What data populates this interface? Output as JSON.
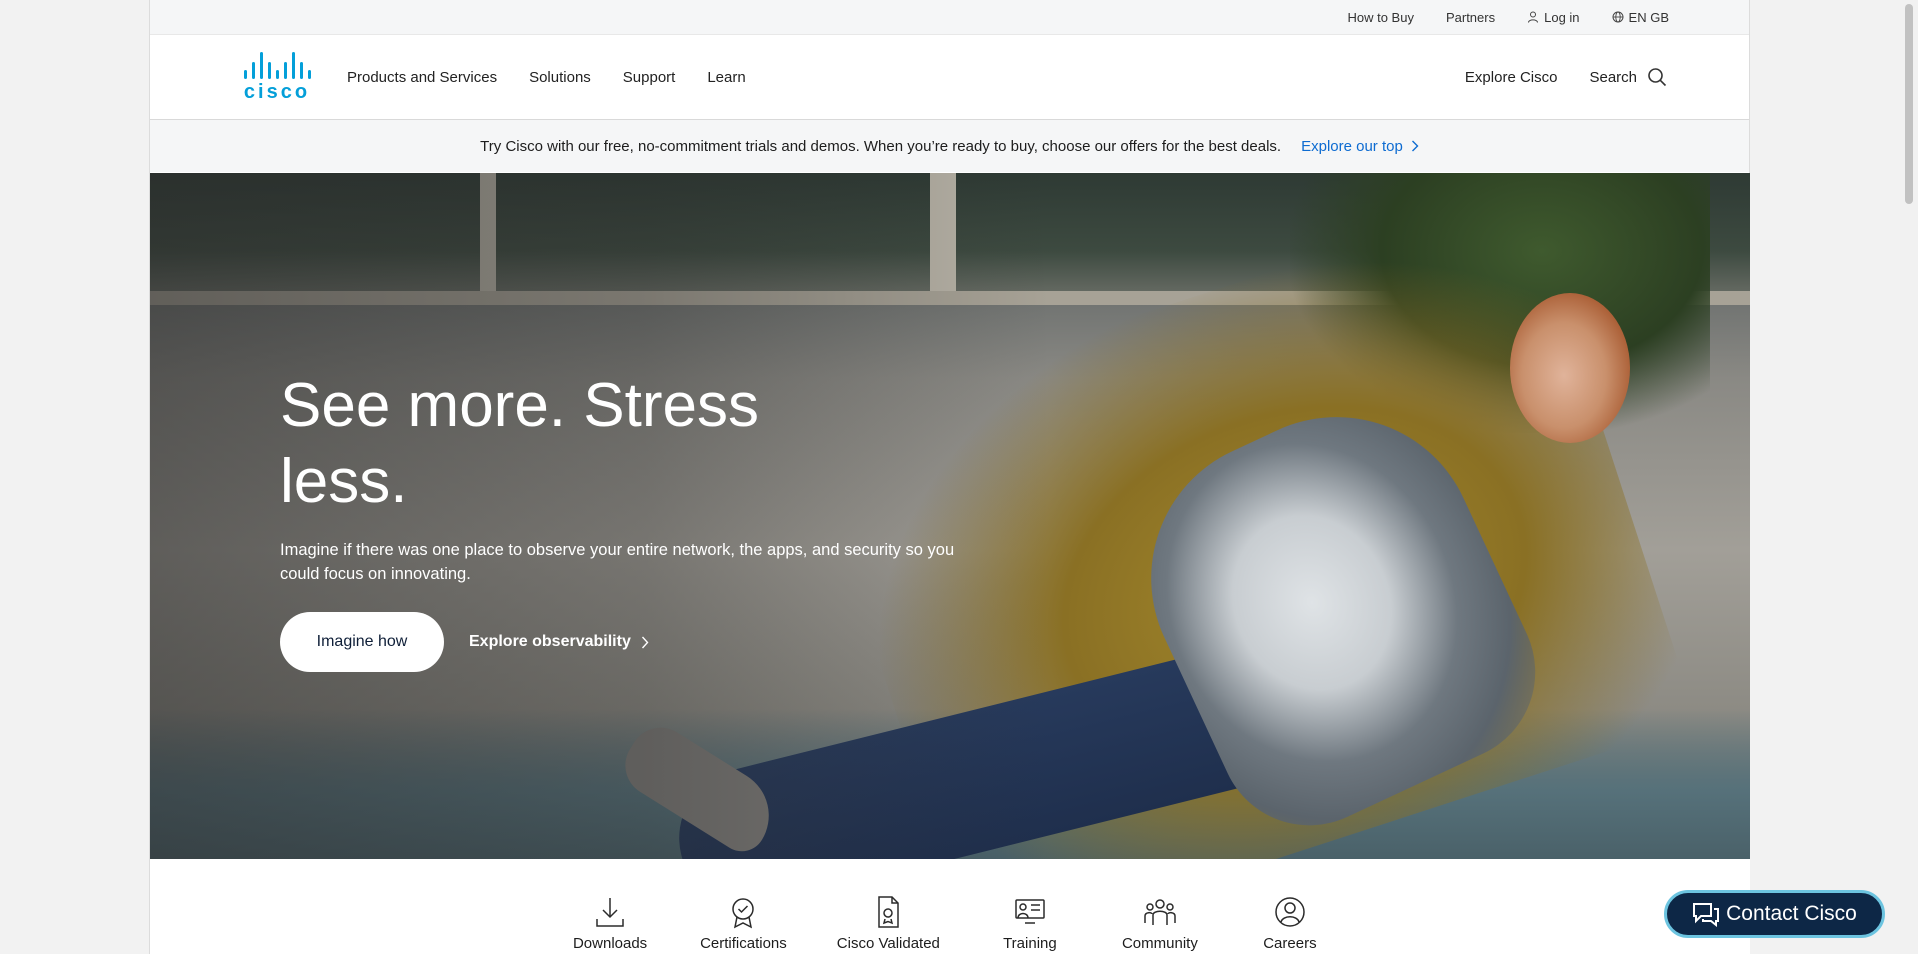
{
  "utility": {
    "how_to_buy": "How to Buy",
    "partners": "Partners",
    "log_in": "Log in",
    "language": "EN GB"
  },
  "brand": {
    "logo_text": "cisco",
    "brand_color": "#049fd9"
  },
  "nav": {
    "items": [
      {
        "label": "Products and Services"
      },
      {
        "label": "Solutions"
      },
      {
        "label": "Support"
      },
      {
        "label": "Learn"
      }
    ],
    "explore": "Explore Cisco",
    "search": "Search"
  },
  "promo": {
    "text": "Try Cisco with our free, no-commitment trials and demos. When you’re ready to buy, choose our offers for the best deals.",
    "link": "Explore our top",
    "link_color": "#0d6bd1"
  },
  "hero": {
    "title": "See more. Stress less.",
    "body": "Imagine if there was one place to observe your entire network, the apps, and security so you could focus on innovating.",
    "primary_cta": "Imagine how",
    "secondary_cta": "Explore observability"
  },
  "quick_links": [
    {
      "label": "Downloads",
      "icon": "download-icon"
    },
    {
      "label": "Certifications",
      "icon": "certification-icon"
    },
    {
      "label": "Cisco Validated",
      "icon": "validated-doc-icon"
    },
    {
      "label": "Training",
      "icon": "training-icon"
    },
    {
      "label": "Community",
      "icon": "community-icon"
    },
    {
      "label": "Careers",
      "icon": "careers-icon"
    }
  ],
  "contact": {
    "label": "Contact Cisco",
    "bg_color": "#0d2746"
  }
}
